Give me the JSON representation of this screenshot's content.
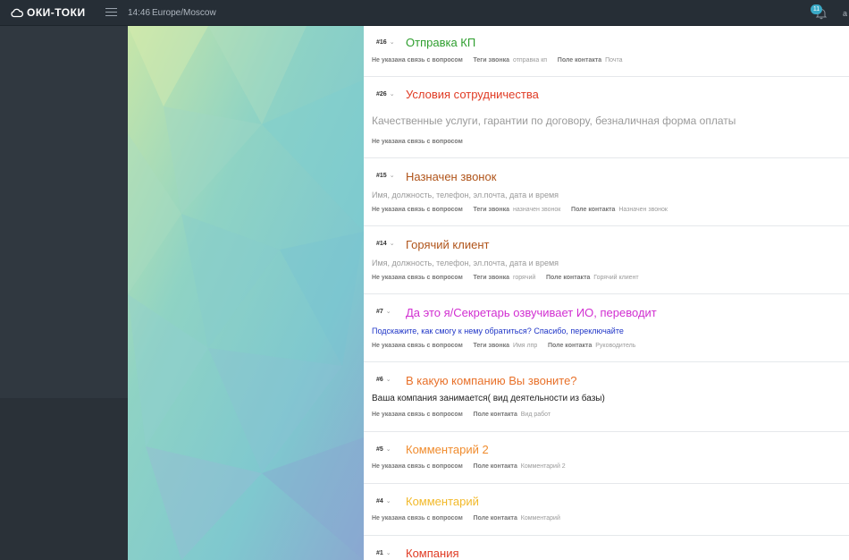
{
  "header": {
    "logo_text": "ОКИ-ТОКИ",
    "time": "14:46",
    "timezone": "Europe/Moscow",
    "notifications_count": "11",
    "user_initials": "a"
  },
  "labels": {
    "no_link": "Не указана связь с вопросом",
    "call_tags": "Теги звонка",
    "contact_field": "Поле контакта"
  },
  "cards": [
    {
      "num": "#16",
      "title": "Отправка КП",
      "title_color": "#2e9e2e",
      "desc": "",
      "tags": "отправка кп",
      "field": "Почта"
    },
    {
      "num": "#26",
      "title": "Условия сотрудничества",
      "title_color": "#e03b24",
      "desc": "Качественные услуги, гарантии по договору, безналичная форма оплаты",
      "tags": "",
      "field": ""
    },
    {
      "num": "#15",
      "title": "Назначен звонок",
      "title_color": "#b0541a",
      "desc": "Имя, должность, телефон, эл.почта, дата и время",
      "tags": "назначен звонок",
      "field": "Назначен звонок"
    },
    {
      "num": "#14",
      "title": "Горячий клиент",
      "title_color": "#b0541a",
      "desc": "Имя, должность, телефон, эл.почта, дата и время",
      "tags": "горячий",
      "field": "Горячий клиент"
    },
    {
      "num": "#7",
      "title": "Да это я/Секретарь озвучивает ИО, переводит",
      "title_color": "#d12fd1",
      "desc": "Подскажите, как смогу к нему обратиться? Спасибо, переключайте",
      "tags": "Имя лпр",
      "field": "Руководитель"
    },
    {
      "num": "#6",
      "title": "В какую компанию Вы звоните?",
      "title_color": "#e8712a",
      "desc": "Ваша компания занимается( вид деятельности из базы)",
      "tags": "",
      "field": "Вид работ"
    },
    {
      "num": "#5",
      "title": "Комментарий 2",
      "title_color": "#f08c2e",
      "desc": "",
      "tags": "",
      "field": "Комментарий 2"
    },
    {
      "num": "#4",
      "title": "Комментарий",
      "title_color": "#f2b92a",
      "desc": "",
      "tags": "",
      "field": "Комментарий"
    },
    {
      "num": "#1",
      "title": "Компания",
      "title_color": "#e03b24",
      "desc": "",
      "tags": "",
      "field": ""
    }
  ]
}
